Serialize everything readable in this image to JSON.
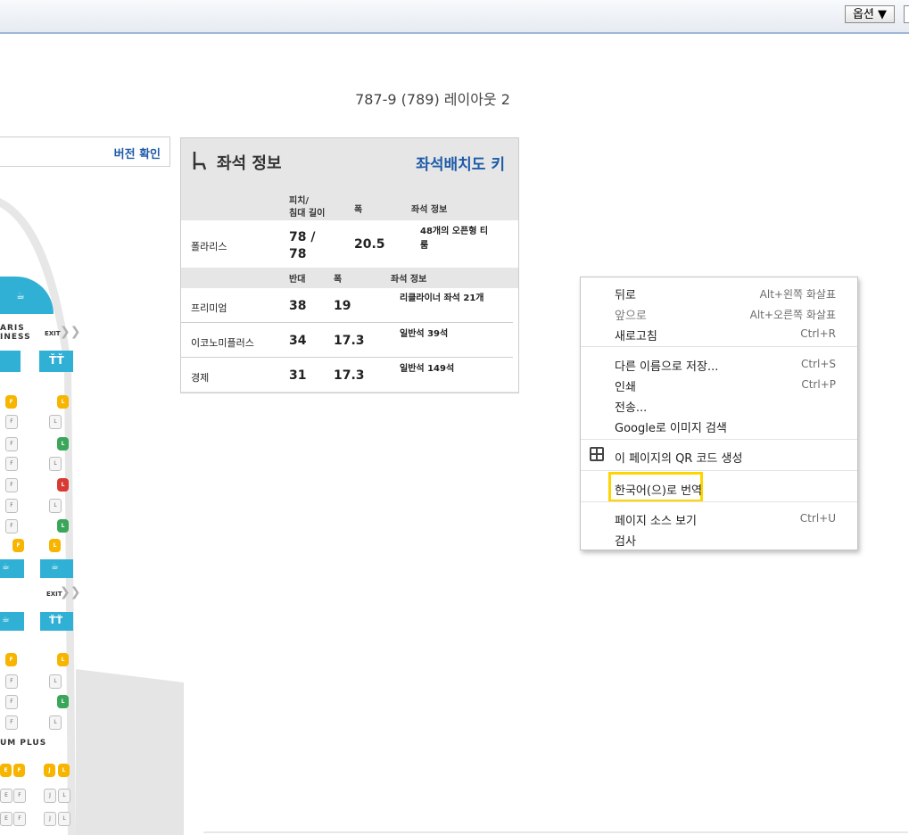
{
  "toolbar": {
    "options_label": "옵션 ▼"
  },
  "page_title": "787-9 (789) 레이아웃 2",
  "version_check": "버전 확인",
  "seat_info": {
    "title": "좌석 정보",
    "key_link": "좌석배치도 키",
    "polaris_header": {
      "pitch": "피치/\n침대 길이",
      "width": "폭",
      "info": "좌석 정보"
    },
    "polaris_row": {
      "name": "폴라리스",
      "pitch": "78 /\n78",
      "width": "20.5",
      "info": "48개의 오픈형 티\n룸"
    },
    "other_header": {
      "pitch": "반대",
      "width": "폭",
      "info": "좌석 정보"
    },
    "rows": [
      {
        "name": "프리미엄",
        "pitch": "38",
        "width": "19",
        "info": "리클라이너 좌석 21개"
      },
      {
        "name": "이코노미플러스",
        "pitch": "34",
        "width": "17.3",
        "info": "일반석 39석"
      },
      {
        "name": "경제",
        "pitch": "31",
        "width": "17.3",
        "info": "일반석 149석"
      }
    ]
  },
  "seat_map": {
    "exit_label": "EXIT",
    "polaris_label_1": "ARIS",
    "polaris_label_2": "INESS",
    "premium_label": "UM PLUS",
    "seat_letters": {
      "f": "F",
      "l": "L",
      "e": "E",
      "j": "J"
    },
    "colors": {
      "accent": "#2fb0d4",
      "yellow": "#f7b500",
      "green": "#3aa65a",
      "red": "#d83a34"
    }
  },
  "context_menu": {
    "items": [
      {
        "label": "뒤로",
        "shortcut": "Alt+왼쪽 화살표",
        "disabled": false
      },
      {
        "label": "앞으로",
        "shortcut": "Alt+오른쪽 화살표",
        "disabled": true
      },
      {
        "label": "새로고침",
        "shortcut": "Ctrl+R",
        "disabled": false
      },
      {
        "label": "다른 이름으로 저장...",
        "shortcut": "Ctrl+S",
        "disabled": false
      },
      {
        "label": "인쇄",
        "shortcut": "Ctrl+P",
        "disabled": false
      },
      {
        "label": "전송...",
        "shortcut": "",
        "disabled": false
      },
      {
        "label": "Google로 이미지 검색",
        "shortcut": "",
        "disabled": false
      },
      {
        "label": "이 페이지의 QR 코드 생성",
        "shortcut": "",
        "disabled": false
      },
      {
        "label": "한국어(으)로 번역",
        "shortcut": "",
        "disabled": false
      },
      {
        "label": "페이지 소스 보기",
        "shortcut": "Ctrl+U",
        "disabled": false
      },
      {
        "label": "검사",
        "shortcut": "",
        "disabled": false
      }
    ],
    "highlight_color": "#ffd500"
  }
}
